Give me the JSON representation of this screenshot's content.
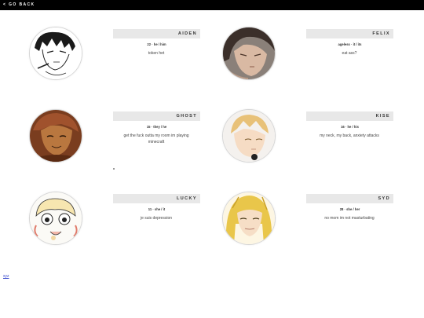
{
  "nav": {
    "go_back": "< GO BACK"
  },
  "profiles": [
    {
      "name": "AIDEN",
      "meta": "22 · he / him",
      "desc": "token het"
    },
    {
      "name": "FELIX",
      "meta": "ageless · it / its",
      "desc": "eat ass?"
    },
    {
      "name": "GHOST",
      "meta": "15 · they / he",
      "desc": "get the fuck outta my room im playing minecraft"
    },
    {
      "name": "KISE",
      "meta": "16 · he / his",
      "desc": "my neck, my back, anxiety attacks"
    },
    {
      "name": "LUCKY",
      "meta": "11 · she / it",
      "desc": "je suis depression"
    },
    {
      "name": "SYD",
      "meta": "28 · she / her",
      "desc": "no mom im not masturbating"
    }
  ],
  "footer": {
    "link": "xyz"
  }
}
